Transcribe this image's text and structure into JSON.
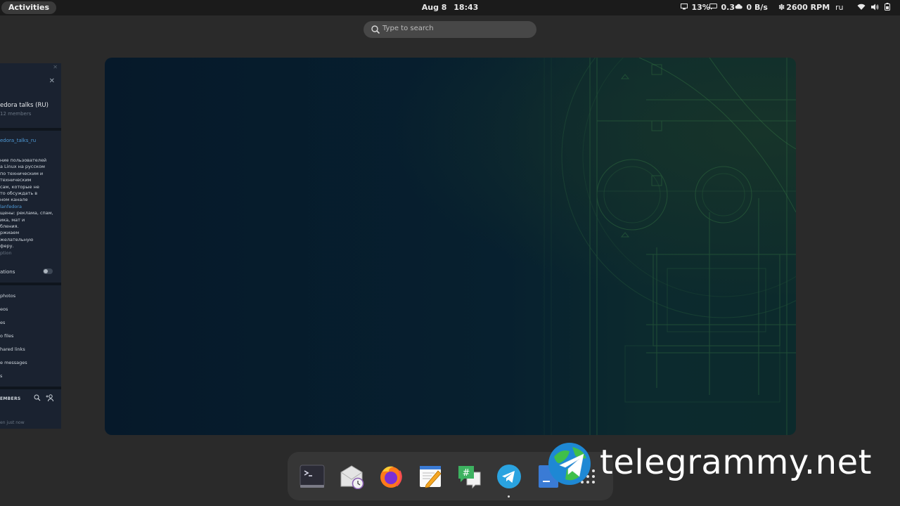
{
  "topbar": {
    "activities": "Activities",
    "date": "Aug 8",
    "time": "18:43",
    "cpu": "13%",
    "load": "0.3",
    "network": "0 B/s",
    "fan": "2600 RPM",
    "keyboard_layout": "ru"
  },
  "search": {
    "placeholder": "Type to search"
  },
  "sidepanel": {
    "group_title": "edora talks (RU)",
    "members_count": "12 members",
    "link": "edora_talks_ru",
    "description_lines": [
      "ние пользователей",
      "а Linux на русском",
      "по техническим и",
      "техническим",
      "сам, которые не",
      "то обсуждать в",
      "ном канале"
    ],
    "description_link": "lanfedora",
    "description_lines2": [
      "щены: реклама, спам,",
      "ика, мат и",
      "бления.",
      "ржиаем",
      "желательную",
      "феру."
    ],
    "description_label": "ption",
    "notifications": "ations",
    "media_items": [
      "photos",
      "eos",
      "es",
      "o files",
      "hared links",
      "e messages",
      "s"
    ],
    "members_header": "EMBERS",
    "joined": "en just now"
  },
  "dock": {
    "apps": [
      "terminal",
      "mail-clock",
      "firefox",
      "text-editor",
      "chat",
      "telegram",
      "document"
    ]
  },
  "watermark": {
    "text": "telegrammy.net"
  },
  "colors": {
    "topbar": "#1b1b1b",
    "overview_bg": "#2a2a2a",
    "wallpaper_dark": "#06192a",
    "wallpaper_lines": "#2f6a3f",
    "link": "#4f9bd8",
    "telegram": "#2aa3e0"
  }
}
